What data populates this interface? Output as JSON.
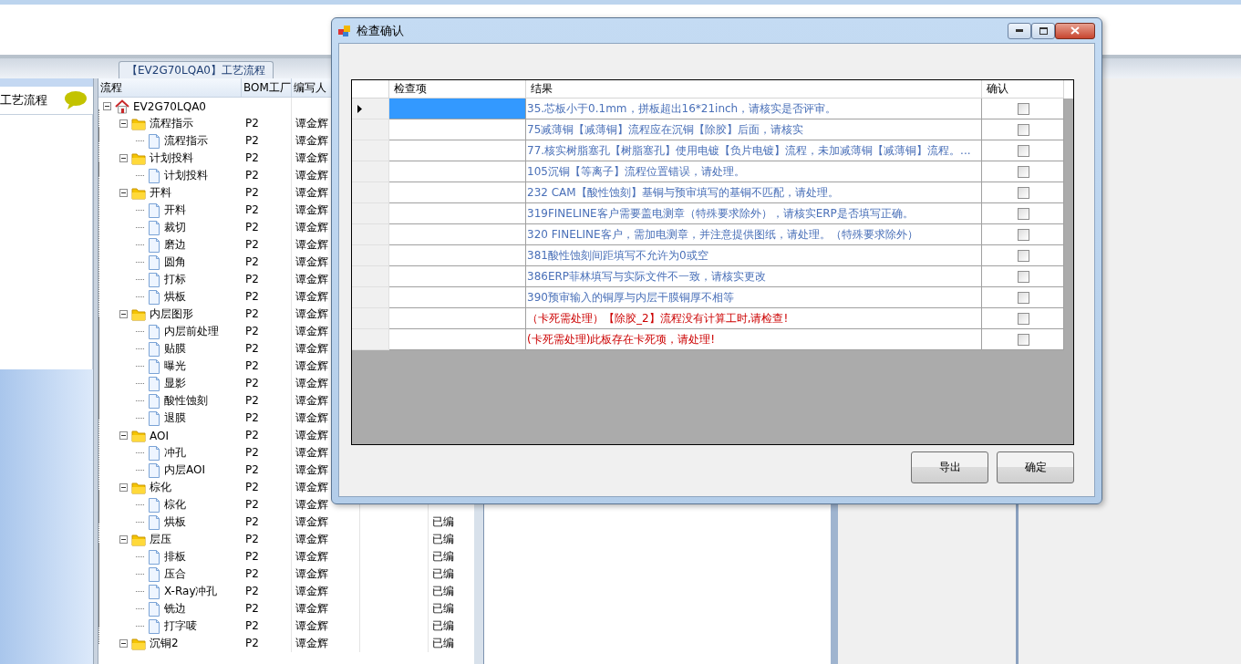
{
  "background": {
    "tab": "【EV2G70LQA0】工艺流程",
    "left_panel": {
      "title": "工艺流程"
    },
    "tree": {
      "columns": [
        "流程",
        "BOM工厂",
        "编写人"
      ],
      "rows": [
        {
          "label": "EV2G70LQA0",
          "kind": "root",
          "expanded": true,
          "children": [
            {
              "label": "流程指示",
              "kind": "folder",
              "expanded": true,
              "bom": "P2",
              "writer": "谭金辉",
              "children": [
                {
                  "label": "流程指示",
                  "kind": "file",
                  "bom": "P2",
                  "writer": "谭金辉"
                }
              ]
            },
            {
              "label": "计划投料",
              "kind": "folder",
              "expanded": true,
              "bom": "P2",
              "writer": "谭金辉",
              "children": [
                {
                  "label": "计划投料",
                  "kind": "file",
                  "bom": "P2",
                  "writer": "谭金辉"
                }
              ]
            },
            {
              "label": "开料",
              "kind": "folder",
              "expanded": true,
              "bom": "P2",
              "writer": "谭金辉",
              "children": [
                {
                  "label": "开料",
                  "kind": "file",
                  "bom": "P2",
                  "writer": "谭金辉"
                },
                {
                  "label": "裁切",
                  "kind": "file",
                  "bom": "P2",
                  "writer": "谭金辉"
                },
                {
                  "label": "磨边",
                  "kind": "file",
                  "bom": "P2",
                  "writer": "谭金辉"
                },
                {
                  "label": "圆角",
                  "kind": "file",
                  "bom": "P2",
                  "writer": "谭金辉"
                },
                {
                  "label": "打标",
                  "kind": "file",
                  "bom": "P2",
                  "writer": "谭金辉"
                },
                {
                  "label": "烘板",
                  "kind": "file",
                  "bom": "P2",
                  "writer": "谭金辉"
                }
              ]
            },
            {
              "label": "内层图形",
              "kind": "folder",
              "expanded": true,
              "bom": "P2",
              "writer": "谭金辉",
              "children": [
                {
                  "label": "内层前处理",
                  "kind": "file",
                  "bom": "P2",
                  "writer": "谭金辉"
                },
                {
                  "label": "贴膜",
                  "kind": "file",
                  "bom": "P2",
                  "writer": "谭金辉"
                },
                {
                  "label": "曝光",
                  "kind": "file",
                  "bom": "P2",
                  "writer": "谭金辉"
                },
                {
                  "label": "显影",
                  "kind": "file",
                  "bom": "P2",
                  "writer": "谭金辉"
                },
                {
                  "label": "酸性蚀刻",
                  "kind": "file",
                  "bom": "P2",
                  "writer": "谭金辉"
                },
                {
                  "label": "退膜",
                  "kind": "file",
                  "bom": "P2",
                  "writer": "谭金辉"
                }
              ]
            },
            {
              "label": "AOI",
              "kind": "folder",
              "expanded": true,
              "bom": "P2",
              "writer": "谭金辉",
              "children": [
                {
                  "label": "冲孔",
                  "kind": "file",
                  "bom": "P2",
                  "writer": "谭金辉"
                },
                {
                  "label": "内层AOI",
                  "kind": "file",
                  "bom": "P2",
                  "writer": "谭金辉"
                }
              ]
            },
            {
              "label": "棕化",
              "kind": "folder",
              "expanded": true,
              "bom": "P2",
              "writer": "谭金辉",
              "children": [
                {
                  "label": "棕化",
                  "kind": "file",
                  "bom": "P2",
                  "writer": "谭金辉"
                },
                {
                  "label": "烘板",
                  "kind": "file",
                  "bom": "P2",
                  "writer": "谭金辉",
                  "status": "已编"
                }
              ]
            },
            {
              "label": "层压",
              "kind": "folder",
              "expanded": true,
              "bom": "P2",
              "writer": "谭金辉",
              "status": "已编",
              "children": [
                {
                  "label": "排板",
                  "kind": "file",
                  "bom": "P2",
                  "writer": "谭金辉",
                  "status": "已编"
                },
                {
                  "label": "压合",
                  "kind": "file",
                  "bom": "P2",
                  "writer": "谭金辉",
                  "status": "已编"
                },
                {
                  "label": "X-Ray冲孔",
                  "kind": "file",
                  "bom": "P2",
                  "writer": "谭金辉",
                  "status": "已编"
                },
                {
                  "label": "铣边",
                  "kind": "file",
                  "bom": "P2",
                  "writer": "谭金辉",
                  "status": "已编"
                },
                {
                  "label": "打字唛",
                  "kind": "file",
                  "bom": "P2",
                  "writer": "谭金辉",
                  "status": "已编"
                }
              ]
            },
            {
              "label": "沉铜2",
              "kind": "folder",
              "expanded": true,
              "bom": "P2",
              "writer": "谭金辉",
              "status": "已编"
            }
          ]
        }
      ]
    }
  },
  "dialog": {
    "title": "检查确认",
    "columns": [
      "检查项",
      "结果",
      "确认"
    ],
    "rows": [
      {
        "selected": true,
        "result": "35.芯板小于0.1mm，拼板超出16*21inch，请核实是否评审。",
        "color": "#4a70b8",
        "checked": false
      },
      {
        "selected": false,
        "result": "75减薄铜【减薄铜】流程应在沉铜【除胶】后面，请核实",
        "color": "#4a70b8",
        "checked": false
      },
      {
        "selected": false,
        "result": "77.核实树脂塞孔【树脂塞孔】使用电镀【负片电镀】流程，未加减薄铜【减薄铜】流程。...",
        "color": "#4a70b8",
        "checked": false
      },
      {
        "selected": false,
        "result": "105沉铜【等离子】流程位置错误，请处理。",
        "color": "#4a70b8",
        "checked": false
      },
      {
        "selected": false,
        "result": "232 CAM【酸性蚀刻】基铜与预审填写的基铜不匹配，请处理。",
        "color": "#4a70b8",
        "checked": false
      },
      {
        "selected": false,
        "result": "319FINELINE客户需要盖电测章（特殊要求除外），请核实ERP是否填写正确。",
        "color": "#4a70b8",
        "checked": false
      },
      {
        "selected": false,
        "result": "320 FINELINE客户，需加电测章，并注意提供图纸，请处理。（特殊要求除外）",
        "color": "#4a70b8",
        "checked": false
      },
      {
        "selected": false,
        "result": "381酸性蚀刻间距填写不允许为0或空",
        "color": "#4a70b8",
        "checked": false
      },
      {
        "selected": false,
        "result": "386ERP菲林填写与实际文件不一致，请核实更改",
        "color": "#4a70b8",
        "checked": false
      },
      {
        "selected": false,
        "result": "390预审输入的铜厚与内层干膜铜厚不相等",
        "color": "#4a70b8",
        "checked": false
      },
      {
        "selected": false,
        "result": "（卡死需处理）【除胶_2】流程没有计算工时,请检查!",
        "color": "#cc0000",
        "checked": false
      },
      {
        "selected": false,
        "result": "(卡死需处理)此板存在卡死项，请处理!",
        "color": "#cc0000",
        "checked": false
      }
    ],
    "buttons": [
      "导出",
      "确定"
    ]
  }
}
